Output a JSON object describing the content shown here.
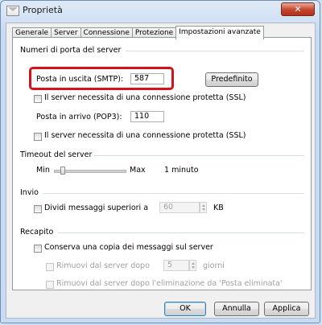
{
  "window": {
    "title": "Proprietà",
    "close_symbol": "✕"
  },
  "tabs": [
    {
      "label": "Generale"
    },
    {
      "label": "Server"
    },
    {
      "label": "Connessione"
    },
    {
      "label": "Protezione"
    },
    {
      "label": "Impostazioni avanzate"
    }
  ],
  "ports_group": {
    "title": "Numeri di porta del server",
    "smtp_label": "Posta in uscita (SMTP):",
    "smtp_value": "587",
    "default_button": "Predefinito",
    "smtp_ssl_label": "Il server necessita di una connessione protetta (SSL)",
    "pop3_label": "Posta in arrivo (POP3):",
    "pop3_value": "110",
    "pop3_ssl_label": "Il server necessita di una connessione protetta (SSL)"
  },
  "timeout_group": {
    "title": "Timeout del server",
    "min_label": "Min",
    "max_label": "Max",
    "value_text": "1 minuto",
    "slider_level": 0.1
  },
  "send_group": {
    "title": "Invio",
    "split_label": "Dividi messaggi superiori a",
    "split_value": "60",
    "unit": "KB"
  },
  "delivery_group": {
    "title": "Recapito",
    "keep_copy_label": "Conserva una copia dei messaggi sul server",
    "remove_after_label": "Rimuovi dal server dopo",
    "remove_days_value": "5",
    "days_unit": "giorni",
    "remove_deleted_label": "Rimuovi dal server dopo l'eliminazione da 'Posta eliminata'"
  },
  "footer": {
    "ok": "OK",
    "cancel": "Annulla",
    "apply": "Applica"
  },
  "colors": {
    "highlight": "#d7111a",
    "close": "#c6432a"
  }
}
